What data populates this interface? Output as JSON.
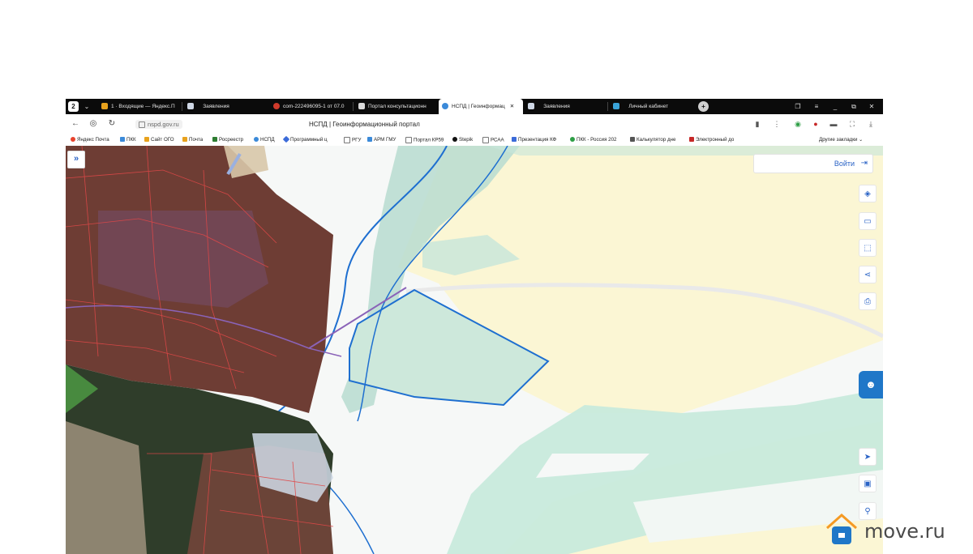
{
  "tabs": [
    {
      "label": "1 · Входящие — Яндекс.П",
      "icon": "mail-icon",
      "color": "#e8a21d"
    },
    {
      "label": "Заявления",
      "icon": "doc-icon",
      "color": "#cfd8e6"
    },
    {
      "label": "com-222496095-1 от 07.0",
      "icon": "pin-icon",
      "color": "#d03a2b"
    },
    {
      "label": "Портал консультационн",
      "icon": "page-icon",
      "color": "#d9d9d9"
    },
    {
      "label": "НСПД | Геоинформац",
      "icon": "globe-icon",
      "color": "#3b8ad9",
      "active": true
    },
    {
      "label": "Заявления",
      "icon": "doc-icon",
      "color": "#cfd8e6"
    },
    {
      "label": "Личный кабинет",
      "icon": "cabinet-icon",
      "color": "#3aa3d8"
    }
  ],
  "address": {
    "url": "nspd.gov.ru",
    "page_title": "НСПД | Геоинформационный портал"
  },
  "bookmarks": [
    {
      "label": "Яндекс Почта",
      "color": "#e8432d"
    },
    {
      "label": "ПКК",
      "color": "#3b8ad9"
    },
    {
      "label": "Сайт ОГО",
      "color": "#e8a21d"
    },
    {
      "label": "Почта",
      "color": "#e8a21d"
    },
    {
      "label": "Росреестр",
      "color": "#2e7d32"
    },
    {
      "label": "НСПД",
      "color": "#3b8ad9"
    },
    {
      "label": "Программный ц",
      "color": "#3b6bd9"
    },
    {
      "label": "РГУ",
      "color": "#777777"
    },
    {
      "label": "АРМ ГМУ",
      "color": "#3b8ad9"
    },
    {
      "label": "Портал КР59",
      "color": "#777777"
    },
    {
      "label": "Stepik",
      "color": "#111111"
    },
    {
      "label": "РСАА",
      "color": "#777777"
    },
    {
      "label": "Презентация КФ",
      "color": "#3b6bd9"
    },
    {
      "label": "ПКК - Россия 202",
      "color": "#2e9e46"
    },
    {
      "label": "Калькулятор дне",
      "color": "#555555"
    },
    {
      "label": "Электронный до",
      "color": "#c62828"
    }
  ],
  "other_bookmarks": "Другие закладки",
  "map": {
    "login_label": "Войти",
    "tools": [
      "layers-icon",
      "ruler-icon",
      "select-area-icon",
      "share-icon",
      "print-icon"
    ],
    "bottom_tools": [
      "locate-icon",
      "minimap-icon",
      "pin-icon"
    ]
  },
  "watermark": {
    "text": "move.ru"
  },
  "colors": {
    "accent": "#2a63c6",
    "parcel_fill": "#cde8db",
    "field_fill": "#fbf6d4",
    "boundary_blue": "#1e6fd0",
    "cadastral_red": "#e04848"
  }
}
